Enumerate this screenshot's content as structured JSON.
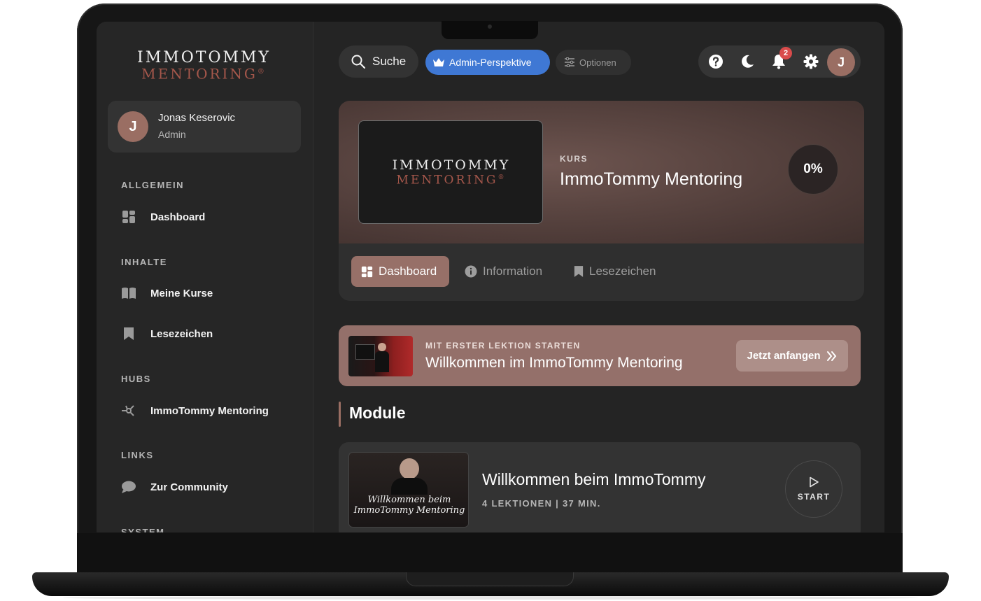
{
  "brand": {
    "logo_line1": "IMMOTOMMY",
    "logo_line2": "MENTORING",
    "registered": "®",
    "accent_color": "#a5574b"
  },
  "user": {
    "name": "Jonas Keserovic",
    "role": "Admin",
    "initial": "J"
  },
  "sidebar": {
    "sections": [
      {
        "label": "ALLGEMEIN",
        "items": [
          {
            "label": "Dashboard",
            "icon": "dashboard-icon"
          }
        ]
      },
      {
        "label": "INHALTE",
        "items": [
          {
            "label": "Meine Kurse",
            "icon": "book-icon"
          },
          {
            "label": "Lesezeichen",
            "icon": "bookmark-icon"
          }
        ]
      },
      {
        "label": "HUBS",
        "items": [
          {
            "label": "ImmoTommy Mentoring",
            "icon": "hub-icon"
          }
        ]
      },
      {
        "label": "LINKS",
        "items": [
          {
            "label": "Zur Community",
            "icon": "chat-bubble-icon"
          }
        ]
      },
      {
        "label": "SYSTEM",
        "items": []
      }
    ]
  },
  "topbar": {
    "search_label": "Suche",
    "admin_label": "Admin-Perspektive",
    "options_label": "Optionen",
    "notification_count": "2",
    "admin_color": "#3f78d4"
  },
  "course": {
    "thumb_line1": "IMMOTOMMY",
    "thumb_line2": "MENTORING",
    "kicker": "KURS",
    "title": "ImmoTommy Mentoring",
    "progress": "0%",
    "tabs": [
      {
        "label": "Dashboard",
        "icon": "dashboard-icon",
        "active": true
      },
      {
        "label": "Information",
        "icon": "info-icon",
        "active": false
      },
      {
        "label": "Lesezeichen",
        "icon": "bookmark-icon",
        "active": false
      }
    ]
  },
  "start_banner": {
    "kicker": "MIT ERSTER LEKTION STARTEN",
    "title": "Willkommen im ImmoTommy Mentoring",
    "button_label": "Jetzt anfangen"
  },
  "modules": {
    "heading": "Module",
    "items": [
      {
        "thumb_caption_line1": "Willkommen beim",
        "thumb_caption_line2": "ImmoTommy Mentoring",
        "title": "Willkommen beim ImmoTommy",
        "meta": "4 LEKTIONEN | 37 MIN.",
        "start_label": "START"
      }
    ]
  }
}
